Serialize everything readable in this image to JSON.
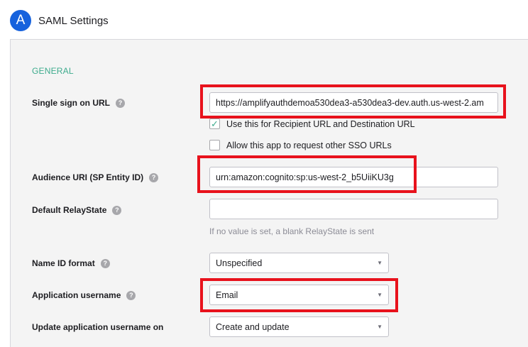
{
  "header": {
    "badge": "A",
    "title": "SAML Settings"
  },
  "general": {
    "section_title": "GENERAL",
    "sso_url": {
      "label": "Single sign on URL",
      "value": "https://amplifyauthdemoa530dea3-a530dea3-dev.auth.us-west-2.am"
    },
    "recipient_checkbox": {
      "label": "Use this for Recipient URL and Destination URL",
      "checked": true
    },
    "other_sso_checkbox": {
      "label": "Allow this app to request other SSO URLs",
      "checked": false
    },
    "audience_uri": {
      "label": "Audience URI (SP Entity ID)",
      "value": "urn:amazon:cognito:sp:us-west-2_b5UiiKU3g"
    },
    "relay_state": {
      "label": "Default RelayState",
      "value": "",
      "hint": "If no value is set, a blank RelayState is sent"
    },
    "name_id_format": {
      "label": "Name ID format",
      "value": "Unspecified"
    },
    "app_username": {
      "label": "Application username",
      "value": "Email"
    },
    "update_username": {
      "label": "Update application username on",
      "value": "Create and update"
    }
  },
  "icons": {
    "help": "?",
    "checkmark": "✓",
    "caret": "▼"
  },
  "colors": {
    "accent_blue": "#1662dd",
    "section_green": "#3eab8d",
    "highlight_red": "#e8121c"
  }
}
